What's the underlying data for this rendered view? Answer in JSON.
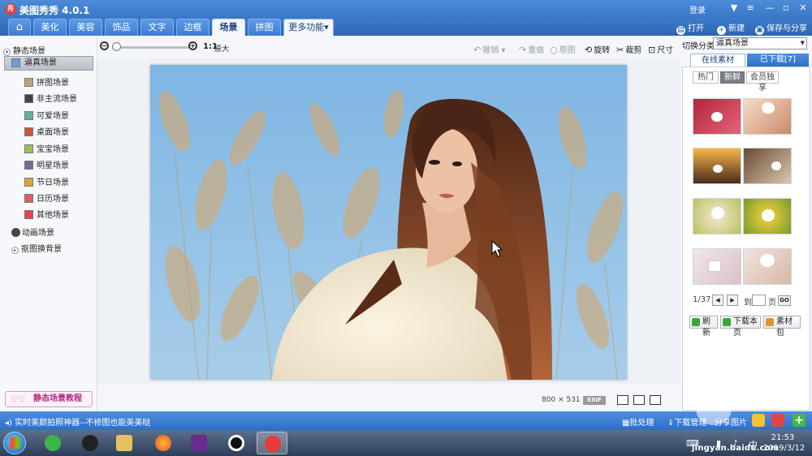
{
  "window": {
    "title": "美图秀秀 4.0.1",
    "logo_text": "秀",
    "login": "登录"
  },
  "nav": {
    "tabs": [
      "美化",
      "美容",
      "饰品",
      "文字",
      "边框",
      "场景",
      "拼图",
      "更多功能"
    ],
    "active_tab": "场景",
    "actions": {
      "open": "打开",
      "new": "新建",
      "save_share": "保存与分享"
    }
  },
  "sidebar": {
    "static_head": "静态场景",
    "items": [
      {
        "label": "逼真场景",
        "selected": true
      },
      {
        "label": "拼图场景"
      },
      {
        "label": "非主流场景"
      },
      {
        "label": "可爱场景"
      },
      {
        "label": "桌面场景"
      },
      {
        "label": "宝宝场景"
      },
      {
        "label": "明星场景"
      },
      {
        "label": "节日场景"
      },
      {
        "label": "日历场景"
      },
      {
        "label": "其他场景"
      }
    ],
    "anim_head": "动画场景",
    "matting_head": "抠图换背景",
    "tutorial": "静态场景教程"
  },
  "toolbar": {
    "ratio": "1:1",
    "original": "原大",
    "undo": "撤销",
    "redo": "重做",
    "original_img": "原图",
    "rotate": "旋转",
    "crop": "裁剪",
    "resize": "尺寸",
    "zoom_level": 0
  },
  "image_info": {
    "width": "800",
    "times": "×",
    "height": "531",
    "exif": "EXIF"
  },
  "right_panel": {
    "switch_label": "切换分类",
    "category": "逼真场景",
    "tabs": [
      "在线素材",
      "已下载[7]"
    ],
    "segments": [
      "热门",
      "新鲜",
      "会员独享"
    ],
    "active_segment": "新鲜",
    "page": "1/37",
    "to": "到",
    "page_unit": "页",
    "go": "GO",
    "buttons": [
      "刷新",
      "下载本页",
      "素材包"
    ]
  },
  "app_status": {
    "tip": "实时美颜拍照神器--不修图也能美美哒",
    "batch": "批处理",
    "download_mgr": "下载管理",
    "share": "分享图片"
  },
  "taskbar": {
    "time": "21:53",
    "date": "2019/3/12"
  },
  "watermark": {
    "text": "jingyan.baidu.com"
  },
  "colors": {
    "accent": "#3a78c6",
    "tutorial": "#b42c82"
  }
}
